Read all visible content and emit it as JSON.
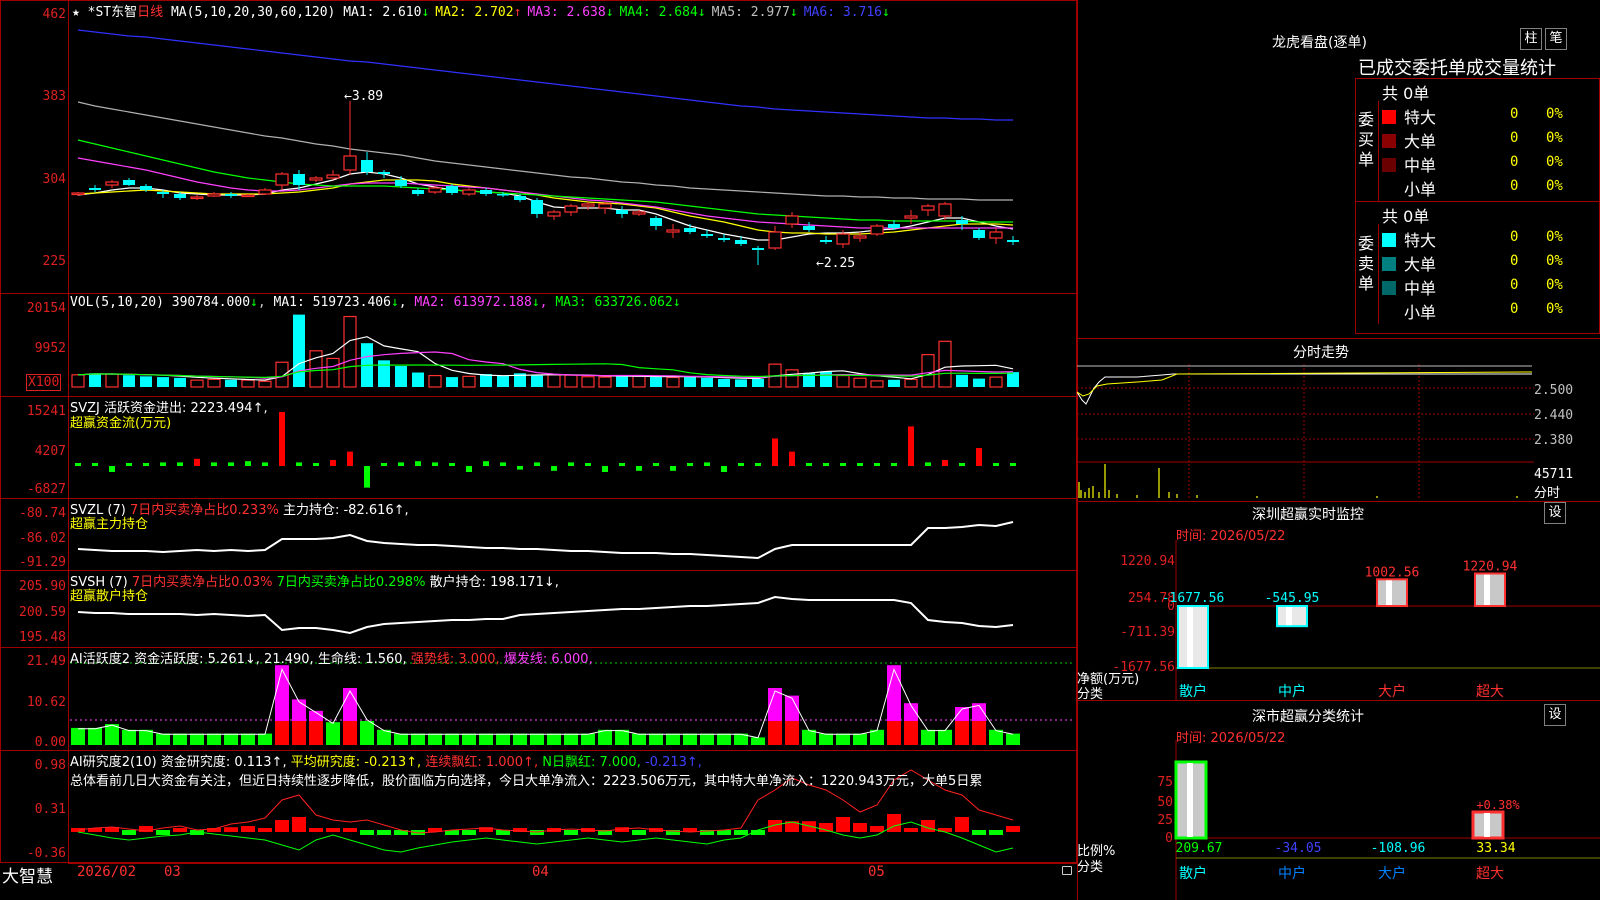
{
  "main": {
    "stock_name": "*ST东智",
    "period": "日线",
    "ma_label": "MA(5,10,20,30,60,120)",
    "ma": [
      {
        "name": "MA1",
        "value": "2.610",
        "arrow": "↓",
        "color": "#ffffff"
      },
      {
        "name": "MA2",
        "value": "2.702",
        "arrow": "↑",
        "color": "#ffff00"
      },
      {
        "name": "MA3",
        "value": "2.638",
        "arrow": "↓",
        "color": "#ff40ff"
      },
      {
        "name": "MA4",
        "value": "2.684",
        "arrow": "↓",
        "color": "#00ff00"
      },
      {
        "name": "MA5",
        "value": "2.977",
        "arrow": "↓",
        "color": "#c0c0c0"
      },
      {
        "name": "MA6",
        "value": "3.716",
        "arrow": "↓",
        "color": "#4040ff"
      }
    ],
    "y_labels": [
      "462",
      "383",
      "304",
      "225"
    ],
    "high_mark": "←3.89",
    "low_mark": "←2.25"
  },
  "vol": {
    "label": "VOL(5,10,20)",
    "value": "390784.000",
    "arrow": "↓",
    "ma": [
      {
        "name": "MA1",
        "value": "519723.406",
        "arrow": "↓",
        "color": "#ffffff"
      },
      {
        "name": "MA2",
        "value": "613972.188",
        "arrow": "↓",
        "color": "#ff40ff"
      },
      {
        "name": "MA3",
        "value": "633726.062",
        "arrow": "↓",
        "color": "#00ff00"
      }
    ],
    "y_labels": [
      "20154",
      "9952"
    ],
    "unit": "X100"
  },
  "svzj": {
    "label": "SVZJ",
    "text": "活跃资金进出: 2223.494↑,",
    "sub": "超赢资金流(万元)",
    "y_labels": [
      "15241",
      "4207",
      "-6827"
    ]
  },
  "svzl": {
    "label": "SVZL (7)",
    "part1": "7日内买卖净占比0.233%",
    "part2": "主力持仓: -82.616↑,",
    "sub": "超赢主力持仓",
    "y_labels": [
      "-80.74",
      "-86.02",
      "-91.29"
    ]
  },
  "svsh": {
    "label": "SVSH (7)",
    "part1": "7日内买卖净占比0.03%",
    "part2": "7日内买卖净占比0.298%",
    "part3": "散户持仓: 198.171↓,",
    "sub": "超赢散户持仓",
    "y_labels": [
      "205.90",
      "200.59",
      "195.48"
    ]
  },
  "ai_active": {
    "label": "AI活跃度2",
    "p1": "资金活跃度: 5.261↓,",
    "p2": "21.490,",
    "p3": "生命线: 1.560,",
    "p4": "强势线: 3.000,",
    "p5": "爆发线: 6.000,",
    "y_labels": [
      "21.49",
      "10.62",
      "0.00"
    ]
  },
  "ai_research": {
    "label": "AI研究度2(10)",
    "p1": "资金研究度: 0.113↑,",
    "p2": "平均研究度: -0.213↑,",
    "p3": "连续飘红: 1.000↑,",
    "p4": "N日飘红: 7.000,",
    "p5": "-0.213↑,",
    "summary": "总体看前几日大资金有关注，但近日持续性逐步降低，股价面临方向选择，今日大单净流入：2223.506万元，其中特大单净流入：1220.943万元，大单5日累",
    "y_labels": [
      "0.98",
      "0.31",
      "-0.36"
    ]
  },
  "bottom": {
    "brand": "大智慧",
    "x_labels": [
      "2026/02",
      "03",
      "04",
      "05"
    ]
  },
  "right": {
    "title": "龙虎看盘(逐单)",
    "btn_bar": "柱",
    "btn_pen": "笔",
    "tabs_text": "已成交委托单成交量统计",
    "buy_total": "共 0单",
    "buy_side": "委买单",
    "sell_total": "共 0单",
    "sell_side": "委卖单",
    "buy_rows": [
      {
        "name": "特大",
        "count": "0",
        "pct": "0%",
        "color": "#ff0000"
      },
      {
        "name": "大单",
        "count": "0",
        "pct": "0%",
        "color": "#8b0000"
      },
      {
        "name": "中单",
        "count": "0",
        "pct": "0%",
        "color": "#6a0000"
      },
      {
        "name": "小单",
        "count": "0",
        "pct": "0%",
        "color": "#000000"
      }
    ],
    "sell_rows": [
      {
        "name": "特大",
        "count": "0",
        "pct": "0%",
        "color": "#00ffff"
      },
      {
        "name": "大单",
        "count": "0",
        "pct": "0%",
        "color": "#008080"
      },
      {
        "name": "中单",
        "count": "0",
        "pct": "0%",
        "color": "#006868"
      },
      {
        "name": "小单",
        "count": "0",
        "pct": "0%",
        "color": "#000000"
      }
    ],
    "intraday_title": "分时走势",
    "intraday_y": [
      "2.500",
      "2.440",
      "2.380"
    ],
    "intraday_vol": "45711",
    "intraday_unit": "分时",
    "monitor_title": "深圳超赢实时监控",
    "monitor_btn": "设",
    "monitor_time": "时间: 2026/05/22",
    "monitor_y": [
      "1220.94",
      "254.78",
      "0",
      "-711.39",
      "-1677.56"
    ],
    "monitor_unit1": "净额(万元)",
    "monitor_unit2": "分类",
    "monitor_bars": [
      {
        "name": "散户",
        "value": -1677.56,
        "label": "-1677.56"
      },
      {
        "name": "中户",
        "value": -545.95,
        "label": "-545.95"
      },
      {
        "name": "大户",
        "value": 1002.56,
        "label": "1002.56"
      },
      {
        "name": "超大",
        "value": 1220.94,
        "label": "1220.94"
      }
    ],
    "class_title": "深市超赢分类统计",
    "class_btn": "设",
    "class_time": "时间: 2026/05/22",
    "class_y": [
      "75",
      "50",
      "25",
      "0"
    ],
    "class_unit1": "比例%",
    "class_unit2": "分类",
    "class_bars": [
      {
        "name": "散户",
        "value": 209.67,
        "label": "209.67"
      },
      {
        "name": "中户",
        "value": -34.05,
        "label": "-34.05"
      },
      {
        "name": "大户",
        "value": -108.96,
        "label": "-108.96"
      },
      {
        "name": "超大",
        "value": 33.34,
        "label": "33.34",
        "extra": "+0.38%"
      }
    ]
  },
  "chart_data": {
    "type": "candlestick",
    "candles": [
      [
        2.96,
        2.98,
        2.94,
        2.97
      ],
      [
        3.02,
        3.05,
        2.98,
        3.0
      ],
      [
        3.05,
        3.1,
        3.02,
        3.08
      ],
      [
        3.1,
        3.12,
        3.04,
        3.05
      ],
      [
        3.04,
        3.06,
        2.98,
        3.0
      ],
      [
        2.98,
        3.0,
        2.92,
        2.96
      ],
      [
        2.96,
        2.98,
        2.9,
        2.92
      ],
      [
        2.92,
        2.95,
        2.9,
        2.93
      ],
      [
        2.94,
        2.98,
        2.93,
        2.96
      ],
      [
        2.96,
        2.98,
        2.92,
        2.94
      ],
      [
        2.94,
        2.96,
        2.93,
        2.95
      ],
      [
        2.96,
        3.02,
        2.95,
        3.0
      ],
      [
        3.05,
        3.18,
        3.0,
        3.16
      ],
      [
        3.16,
        3.2,
        3.0,
        3.05
      ],
      [
        3.1,
        3.14,
        3.08,
        3.12
      ],
      [
        3.12,
        3.2,
        3.1,
        3.15
      ],
      [
        3.2,
        3.89,
        3.15,
        3.34
      ],
      [
        3.3,
        3.38,
        3.15,
        3.18
      ],
      [
        3.18,
        3.2,
        3.12,
        3.16
      ],
      [
        3.1,
        3.14,
        3.02,
        3.04
      ],
      [
        3.0,
        3.02,
        2.94,
        2.96
      ],
      [
        2.98,
        3.04,
        2.96,
        3.02
      ],
      [
        3.04,
        3.06,
        2.95,
        2.97
      ],
      [
        2.96,
        3.02,
        2.94,
        3.0
      ],
      [
        3.0,
        3.02,
        2.94,
        2.96
      ],
      [
        2.96,
        2.98,
        2.93,
        2.95
      ],
      [
        2.94,
        2.96,
        2.88,
        2.9
      ],
      [
        2.9,
        2.92,
        2.72,
        2.76
      ],
      [
        2.74,
        2.8,
        2.7,
        2.78
      ],
      [
        2.78,
        2.86,
        2.74,
        2.84
      ],
      [
        2.84,
        2.88,
        2.8,
        2.86
      ],
      [
        2.82,
        2.88,
        2.76,
        2.86
      ],
      [
        2.8,
        2.84,
        2.72,
        2.76
      ],
      [
        2.76,
        2.8,
        2.74,
        2.78
      ],
      [
        2.72,
        2.74,
        2.6,
        2.64
      ],
      [
        2.58,
        2.66,
        2.52,
        2.6
      ],
      [
        2.62,
        2.66,
        2.56,
        2.58
      ],
      [
        2.56,
        2.6,
        2.52,
        2.54
      ],
      [
        2.52,
        2.56,
        2.48,
        2.5
      ],
      [
        2.5,
        2.54,
        2.44,
        2.46
      ],
      [
        2.42,
        2.44,
        2.25,
        2.4
      ],
      [
        2.42,
        2.64,
        2.4,
        2.58
      ],
      [
        2.66,
        2.78,
        2.62,
        2.74
      ],
      [
        2.64,
        2.68,
        2.58,
        2.6
      ],
      [
        2.5,
        2.54,
        2.46,
        2.48
      ],
      [
        2.46,
        2.6,
        2.42,
        2.56
      ],
      [
        2.52,
        2.58,
        2.48,
        2.54
      ],
      [
        2.56,
        2.66,
        2.54,
        2.64
      ],
      [
        2.66,
        2.7,
        2.6,
        2.62
      ],
      [
        2.72,
        2.8,
        2.66,
        2.74
      ],
      [
        2.8,
        2.86,
        2.74,
        2.84
      ],
      [
        2.74,
        2.88,
        2.7,
        2.86
      ],
      [
        2.7,
        2.74,
        2.6,
        2.66
      ],
      [
        2.6,
        2.62,
        2.5,
        2.52
      ],
      [
        2.52,
        2.62,
        2.46,
        2.58
      ],
      [
        2.5,
        2.54,
        2.45,
        2.48
      ]
    ],
    "ma": {
      "MA1": [
        2.95,
        2.97,
        3.0,
        3.02,
        3.02,
        3.0,
        2.97,
        2.96,
        2.95,
        2.95,
        2.95,
        2.96,
        3.0,
        3.02,
        3.06,
        3.1,
        3.16,
        3.18,
        3.16,
        3.12,
        3.06,
        3.03,
        3.0,
        2.99,
        2.98,
        2.97,
        2.94,
        2.88,
        2.83,
        2.82,
        2.82,
        2.82,
        2.8,
        2.8,
        2.76,
        2.7,
        2.64,
        2.6,
        2.56,
        2.53,
        2.5,
        2.5,
        2.53,
        2.56,
        2.57,
        2.57,
        2.58,
        2.6,
        2.61,
        2.64,
        2.68,
        2.72,
        2.72,
        2.68,
        2.64,
        2.61
      ],
      "MA2": [
        2.96,
        2.97,
        2.98,
        2.99,
        3.0,
        2.99,
        2.98,
        2.97,
        2.96,
        2.96,
        2.96,
        2.96,
        2.97,
        2.98,
        3.0,
        3.02,
        3.06,
        3.08,
        3.1,
        3.1,
        3.1,
        3.09,
        3.06,
        3.04,
        3.02,
        3.0,
        2.98,
        2.95,
        2.92,
        2.9,
        2.88,
        2.87,
        2.86,
        2.84,
        2.82,
        2.78,
        2.74,
        2.71,
        2.68,
        2.64,
        2.6,
        2.58,
        2.57,
        2.57,
        2.56,
        2.56,
        2.56,
        2.57,
        2.58,
        2.6,
        2.62,
        2.64,
        2.66,
        2.66,
        2.66,
        2.65
      ],
      "MA3": [
        3.32,
        3.29,
        3.26,
        3.23,
        3.2,
        3.16,
        3.12,
        3.08,
        3.05,
        3.02,
        3.0,
        2.99,
        2.99,
        3.0,
        3.02,
        3.04,
        3.06,
        3.07,
        3.07,
        3.07,
        3.06,
        3.05,
        3.04,
        3.03,
        3.02,
        3.0,
        2.98,
        2.96,
        2.94,
        2.92,
        2.9,
        2.89,
        2.87,
        2.85,
        2.83,
        2.8,
        2.77,
        2.74,
        2.72,
        2.7,
        2.68,
        2.67,
        2.66,
        2.65,
        2.64,
        2.63,
        2.62,
        2.62,
        2.62,
        2.62,
        2.62,
        2.62,
        2.62,
        2.62,
        2.62,
        2.62
      ],
      "MA4": [
        3.5,
        3.46,
        3.42,
        3.38,
        3.34,
        3.3,
        3.26,
        3.22,
        3.18,
        3.15,
        3.12,
        3.1,
        3.08,
        3.06,
        3.05,
        3.04,
        3.04,
        3.04,
        3.04,
        3.03,
        3.02,
        3.01,
        3.0,
        2.99,
        2.98,
        2.97,
        2.96,
        2.95,
        2.94,
        2.93,
        2.92,
        2.91,
        2.9,
        2.89,
        2.88,
        2.86,
        2.84,
        2.82,
        2.8,
        2.78,
        2.76,
        2.75,
        2.74,
        2.73,
        2.72,
        2.71,
        2.7,
        2.7,
        2.69,
        2.69,
        2.69,
        2.69,
        2.69,
        2.68,
        2.68,
        2.68
      ],
      "MA5": [
        3.88,
        3.84,
        3.81,
        3.78,
        3.75,
        3.72,
        3.69,
        3.66,
        3.63,
        3.6,
        3.57,
        3.54,
        3.52,
        3.49,
        3.46,
        3.44,
        3.41,
        3.39,
        3.37,
        3.35,
        3.32,
        3.29,
        3.27,
        3.25,
        3.23,
        3.21,
        3.19,
        3.17,
        3.15,
        3.13,
        3.12,
        3.1,
        3.08,
        3.07,
        3.05,
        3.04,
        3.02,
        3.01,
        3.0,
        2.99,
        2.98,
        2.97,
        2.96,
        2.95,
        2.94,
        2.94,
        2.93,
        2.93,
        2.92,
        2.92,
        2.91,
        2.91,
        2.91,
        2.9,
        2.9,
        2.9
      ],
      "MA6": [
        4.6,
        4.58,
        4.56,
        4.54,
        4.53,
        4.51,
        4.49,
        4.47,
        4.45,
        4.43,
        4.41,
        4.39,
        4.37,
        4.35,
        4.33,
        4.31,
        4.29,
        4.28,
        4.26,
        4.24,
        4.22,
        4.2,
        4.18,
        4.16,
        4.14,
        4.12,
        4.1,
        4.08,
        4.06,
        4.04,
        4.02,
        4.0,
        3.98,
        3.96,
        3.94,
        3.92,
        3.9,
        3.88,
        3.86,
        3.84,
        3.83,
        3.81,
        3.8,
        3.79,
        3.78,
        3.77,
        3.76,
        3.75,
        3.74,
        3.73,
        3.72,
        3.72,
        3.71,
        3.71,
        3.7,
        3.7
      ]
    },
    "volume": [
      3200,
      3600,
      3400,
      3100,
      2800,
      2600,
      2400,
      1800,
      2000,
      1900,
      1800,
      1500,
      6500,
      19000,
      9500,
      7500,
      18500,
      11500,
      7000,
      5500,
      3800,
      3000,
      2600,
      2800,
      3400,
      3000,
      3600,
      3000,
      3200,
      3100,
      2700,
      2600,
      2800,
      2900,
      2800,
      2500,
      2600,
      2400,
      2100,
      2000,
      2100,
      6000,
      4500,
      3700,
      4100,
      3000,
      2300,
      1600,
      1900,
      2000,
      8500,
      12000,
      3200,
      2200,
      2600,
      3900
    ],
    "price_ylim": [
      2.1,
      4.8
    ]
  }
}
